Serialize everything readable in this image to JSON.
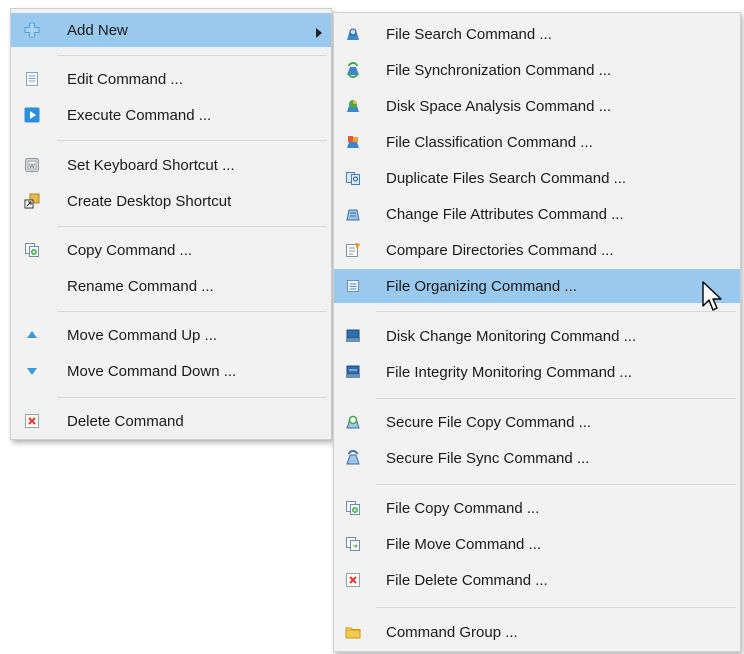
{
  "main_menu": {
    "items": [
      {
        "label": "Add New",
        "icon": "plus-icon"
      },
      {
        "label": "Edit Command ..."
      },
      {
        "label": "Execute Command ..."
      },
      {
        "label": "Set Keyboard Shortcut ..."
      },
      {
        "label": "Create Desktop Shortcut"
      },
      {
        "label": "Copy Command ..."
      },
      {
        "label": "Rename Command ..."
      },
      {
        "label": "Move Command Up ..."
      },
      {
        "label": "Move Command Down ..."
      },
      {
        "label": "Delete Command"
      }
    ]
  },
  "sub_menu": {
    "items": [
      {
        "label": "File Search Command ..."
      },
      {
        "label": "File Synchronization Command ..."
      },
      {
        "label": "Disk Space Analysis Command ..."
      },
      {
        "label": "File Classification Command ..."
      },
      {
        "label": "Duplicate Files Search Command ..."
      },
      {
        "label": "Change File Attributes Command ..."
      },
      {
        "label": "Compare Directories Command ..."
      },
      {
        "label": "File Organizing Command ..."
      },
      {
        "label": "Disk Change Monitoring Command ..."
      },
      {
        "label": "File Integrity Monitoring Command ..."
      },
      {
        "label": "Secure File Copy Command ..."
      },
      {
        "label": "Secure File Sync Command ..."
      },
      {
        "label": "File Copy Command ..."
      },
      {
        "label": "File Move Command ..."
      },
      {
        "label": "File Delete Command ..."
      },
      {
        "label": "Command Group ..."
      }
    ]
  },
  "colors": {
    "highlight": "#99c9ef",
    "menu_bg": "#f2f2f2",
    "separator": "#d8d8d8"
  }
}
